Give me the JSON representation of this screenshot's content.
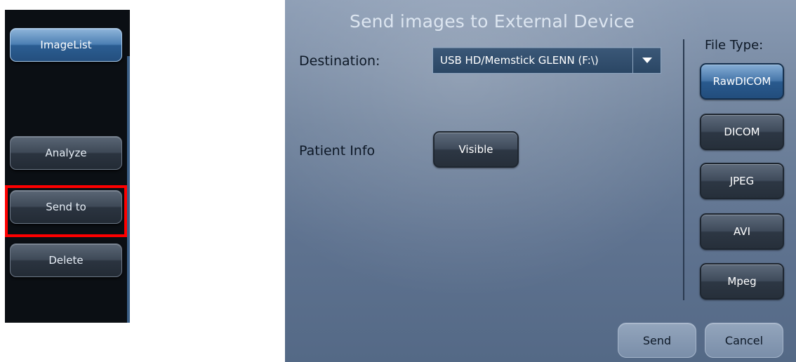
{
  "left_panel": {
    "image_list_label": "ImageList",
    "analyze_label": "Analyze",
    "send_to_label": "Send to",
    "delete_label": "Delete"
  },
  "dialog": {
    "title": "Send images to External Device",
    "destination_label": "Destination:",
    "destination_value": "USB HD/Memstick GLENN (F:\\)",
    "patient_info_label": "Patient Info",
    "patient_info_button": "Visible",
    "file_type_label": "File Type:",
    "file_types": [
      "RawDICOM",
      "DICOM",
      "JPEG",
      "AVI",
      "Mpeg"
    ],
    "selected_file_type": "RawDICOM",
    "send_label": "Send",
    "cancel_label": "Cancel"
  },
  "colors": {
    "highlight": "#ff0000",
    "selected_button": "#3a6ea5"
  },
  "icons": {
    "dropdown": "triangle-down-icon"
  }
}
